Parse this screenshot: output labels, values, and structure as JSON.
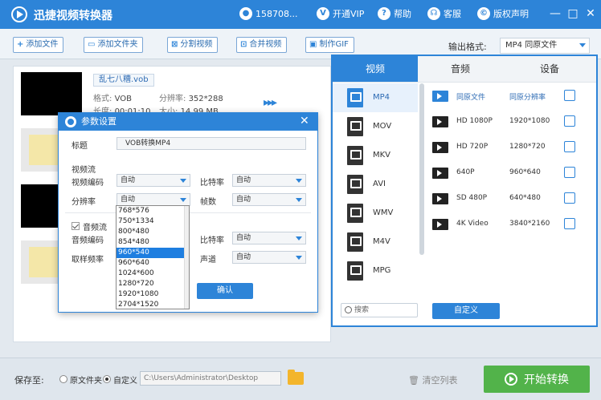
{
  "title": {
    "app_title": "迅捷视频转换器",
    "user": "158708...",
    "vip": "开通VIP",
    "help": "帮助",
    "service": "客服",
    "copyright": "版权声明"
  },
  "toolbar": {
    "add_file": "添加文件",
    "add_folder": "添加文件夹",
    "split_video": "分割视频",
    "merge_video": "合并视频",
    "make_gif": "制作GIF",
    "output_format_label": "输出格式:",
    "output_format_value": "MP4  同原文件"
  },
  "files": [
    {
      "name": "乱七八糟.vob",
      "format_label": "格式:",
      "format": "VOB",
      "res_label": "分辨率:",
      "res": "352*288",
      "dur_label": "长度:",
      "dur": "00:01:10",
      "size_label": "大小:",
      "size": "14.99 MB"
    }
  ],
  "dialog": {
    "title": "参数设置",
    "title_label": "标题",
    "title_value": "VOB转换MP4",
    "video_stream": "视频流",
    "video_codec_label": "视频编码",
    "video_codec": "自动",
    "bitrate_label": "比特率",
    "bitrate": "自动",
    "resolution_label": "分辨率",
    "resolution": "自动",
    "fps_label": "帧数",
    "fps": "自动",
    "audio_stream": "音频流",
    "audio_codec_label": "音频编码",
    "audio_bitrate_label": "比特率",
    "audio_bitrate": "自动",
    "sample_label": "取样频率",
    "channel_label": "声道",
    "channel": "自动",
    "confirm": "确认",
    "dropdown_options": [
      "768*576",
      "750*1334",
      "800*480",
      "854*480",
      "960*540",
      "960*640",
      "1024*600",
      "1280*720",
      "1920*1080",
      "2704*1520"
    ],
    "dropdown_selected": "960*540"
  },
  "format_panel": {
    "tabs": [
      "视频",
      "音频",
      "设备"
    ],
    "active_tab": "视频",
    "categories": [
      "MP4",
      "MOV",
      "MKV",
      "AVI",
      "WMV",
      "M4V",
      "MPG"
    ],
    "active_category": "MP4",
    "options": [
      {
        "name": "同原文件",
        "res": "同原分辨率"
      },
      {
        "name": "HD 1080P",
        "res": "1920*1080"
      },
      {
        "name": "HD 720P",
        "res": "1280*720"
      },
      {
        "name": "640P",
        "res": "960*640"
      },
      {
        "name": "SD 480P",
        "res": "640*480"
      },
      {
        "name": "4K Video",
        "res": "3840*2160"
      }
    ],
    "search_placeholder": "搜索",
    "custom": "自定义"
  },
  "bottom": {
    "save_to": "保存至:",
    "original_folder": "原文件夹",
    "custom": "自定义",
    "path": "C:\\Users\\Administrator\\Desktop",
    "clear_list": "清空列表",
    "start": "开始转换"
  },
  "colors": {
    "accent": "#2d84d8",
    "start_green": "#52b34a"
  }
}
